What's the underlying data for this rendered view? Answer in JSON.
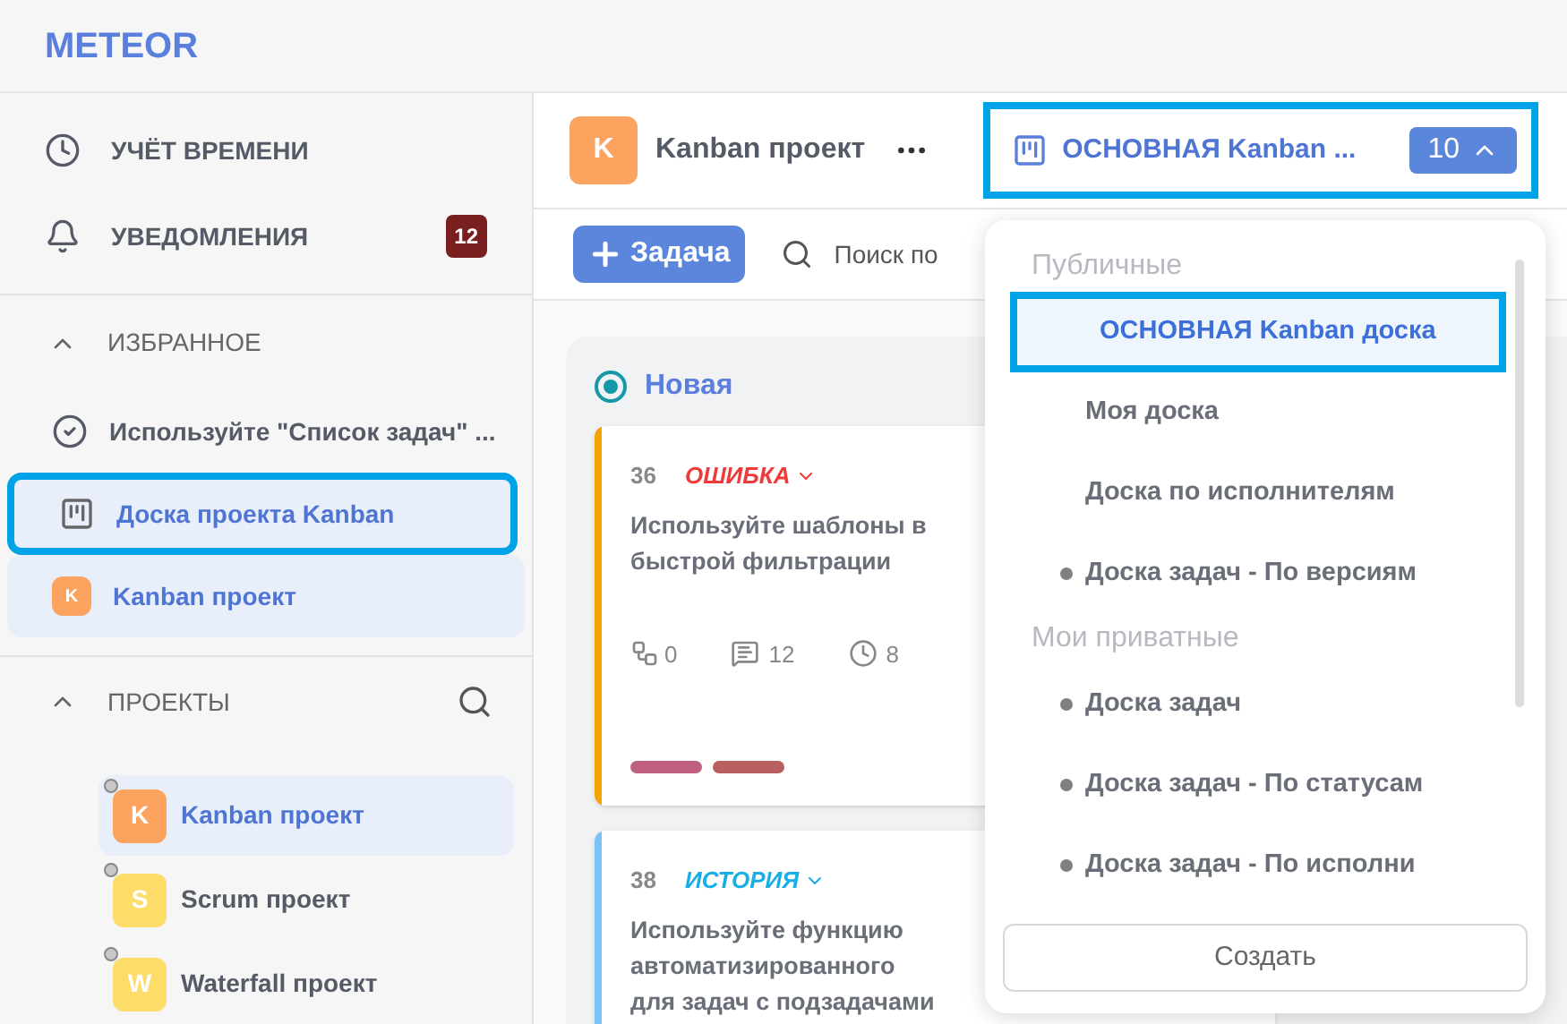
{
  "logo": "METEOR",
  "nav": [
    {
      "kind": "clock",
      "label": "УЧЁТ ВРЕМЕНИ"
    },
    {
      "kind": "bell",
      "label": "УВЕДОМЛЕНИЯ",
      "badge": "12"
    }
  ],
  "favorites": {
    "title": "ИЗБРАННОЕ",
    "expanded": true,
    "items": [
      {
        "kind": "task",
        "label": "Используйте \"Список задач\" ...",
        "selected": false,
        "highlighted": false
      },
      {
        "kind": "board",
        "label": "Доска проекта Kanban",
        "selected": false,
        "highlighted": true
      },
      {
        "kind": "project",
        "avatar": "K",
        "color": "#fca35f",
        "label": "Kanban проект",
        "selected": true,
        "highlighted": false
      }
    ]
  },
  "projects": {
    "title": "ПРОЕКТЫ",
    "expanded": true,
    "items": [
      {
        "avatar": "K",
        "color": "#fca35f",
        "label": "Kanban проект",
        "selected": true
      },
      {
        "avatar": "S",
        "color": "#fddc6a",
        "label": "Scrum проект",
        "selected": false
      },
      {
        "avatar": "W",
        "color": "#fddc6a",
        "label": "Waterfall проект",
        "selected": false
      }
    ]
  },
  "header": {
    "avatar": "K",
    "color": "#fca35f",
    "title": "Kanban проект",
    "board_selector": {
      "label": "ОСНОВНАЯ Kanban ...",
      "count": "10",
      "expanded": true,
      "highlighted": true
    }
  },
  "toolbar": {
    "add_button": "Задача",
    "search_placeholder": "Поиск по"
  },
  "column": {
    "title": "Новая",
    "cards": [
      {
        "number": "36",
        "type": {
          "label": "ОШИБКА",
          "color": "#ee3a3a"
        },
        "accent": {
          "color": "#f5a300"
        },
        "lines": [
          "Используйте шаблоны в",
          "быстрой фильтрации"
        ],
        "subtasks": "0",
        "comments": "12",
        "time": "8",
        "tags": [
          {
            "color": "#c0607e"
          },
          {
            "color": "#b95f5f"
          }
        ]
      },
      {
        "number": "38",
        "type": {
          "label": "ИСТОРИЯ",
          "color": "#18aee8"
        },
        "accent": {
          "color": "#7cc3f5"
        },
        "lines": [
          "Используйте функцию",
          "автоматизированного",
          "для задач с подзадачами"
        ]
      }
    ]
  },
  "dropdown": {
    "groups": [
      {
        "title": "Публичные",
        "items": [
          {
            "label": "ОСНОВНАЯ Kanban доска",
            "selected": true,
            "dot": false
          },
          {
            "label": "Моя доска",
            "selected": false,
            "dot": false
          },
          {
            "label": "Доска по исполнителям",
            "selected": false,
            "dot": false
          },
          {
            "label": "Доска задач - По версиям",
            "selected": false,
            "dot": true
          }
        ]
      },
      {
        "title": "Мои приватные",
        "items": [
          {
            "label": "Доска задач",
            "selected": false,
            "dot": true
          },
          {
            "label": "Доска задач - По статусам",
            "selected": false,
            "dot": true
          },
          {
            "label": "Доска задач - По исполни",
            "selected": false,
            "dot": true
          }
        ]
      }
    ],
    "create_button": "Создать"
  }
}
